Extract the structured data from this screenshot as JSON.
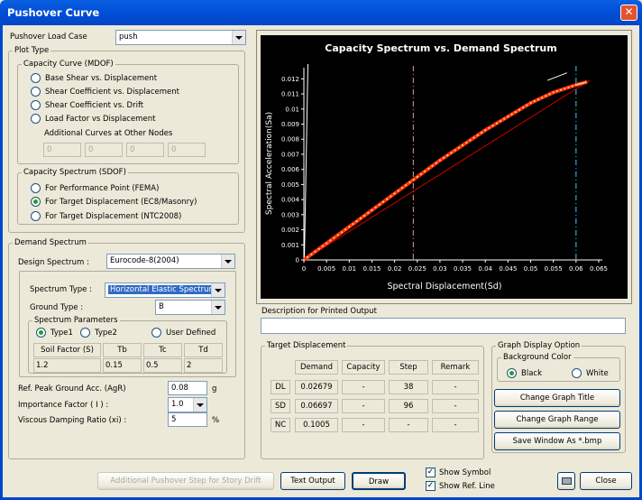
{
  "window": {
    "title": "Pushover Curve"
  },
  "load_case": {
    "label": "Pushover Load Case",
    "value": "push"
  },
  "plot_type": {
    "legend": "Plot Type",
    "mdof": {
      "legend": "Capacity Curve (MDOF)",
      "options": [
        "Base Shear vs. Displacement",
        "Shear Coefficient vs. Displacement",
        "Shear Coefficient vs. Drift",
        "Load Factor vs Displacement"
      ],
      "additional_label": "Additional Curves at Other Nodes",
      "node_values": [
        "0",
        "0",
        "0",
        "0"
      ]
    },
    "sdof": {
      "legend": "Capacity Spectrum (SDOF)",
      "options": [
        "For Performance Point (FEMA)",
        "For Target Displacement (EC8/Masonry)",
        "For Target Displacement (NTC2008)"
      ],
      "selected": 1
    }
  },
  "demand": {
    "legend": "Demand Spectrum",
    "design_label": "Design Spectrum :",
    "design_value": "Eurocode-8(2004)",
    "spectrum_type_label": "Spectrum Type :",
    "spectrum_type_value": "Horizontal Elastic Spectrum",
    "ground_type_label": "Ground Type :",
    "ground_type_value": "B",
    "params_legend": "Spectrum Parameters",
    "param_options": [
      "Type1",
      "Type2",
      "User Defined"
    ],
    "headers": [
      "Soil Factor (S)",
      "Tb",
      "Tc",
      "Td"
    ],
    "values": [
      "1.2",
      "0.15",
      "0.5",
      "2"
    ],
    "agr_label": "Ref. Peak Ground Acc. (AgR)",
    "agr_value": "0.08",
    "agr_unit": "g",
    "imp_label": "Importance Factor ( I ) :",
    "imp_value": "1.0",
    "damp_label": "Viscous Damping Ratio (xi) :",
    "damp_value": "5",
    "damp_unit": "%"
  },
  "chart_title": "Capacity Spectrum vs. Demand Spectrum",
  "chart_data": {
    "type": "line",
    "title": "Capacity Spectrum vs. Demand Spectrum",
    "xlabel": "Spectral Displacement(Sd)",
    "ylabel": "Spectral Acceleration(Sa)",
    "xlim": [
      0,
      0.065
    ],
    "ylim": [
      0,
      0.0125
    ],
    "xticks": [
      "0",
      "0.005",
      "0.01",
      "0.015",
      "0.02",
      "0.025",
      "0.03",
      "0.035",
      "0.04",
      "0.045",
      "0.05",
      "0.055",
      "0.06",
      "0.065"
    ],
    "yticks": [
      "0",
      "0.001",
      "0.002",
      "0.003",
      "0.004",
      "0.005",
      "0.006",
      "0.007",
      "0.008",
      "0.009",
      "0.01",
      "0.011",
      "0.012"
    ],
    "series": [
      {
        "color": "#ff3300",
        "x": [
          0,
          0.005,
          0.01,
          0.015,
          0.02,
          0.025,
          0.03,
          0.035,
          0.04,
          0.045,
          0.05,
          0.055,
          0.06,
          0.0625
        ],
        "y": [
          0,
          0.0011,
          0.0022,
          0.0033,
          0.0044,
          0.0055,
          0.0066,
          0.0076,
          0.0086,
          0.0095,
          0.0104,
          0.0111,
          0.0116,
          0.0118
        ]
      }
    ],
    "bilinear": {
      "color": "#cc0000",
      "x": [
        0,
        0.063
      ],
      "y": [
        0,
        0.0119
      ]
    },
    "vlines": [
      {
        "x": 0.02413,
        "color": "#c77c7c"
      },
      {
        "x": 0.06,
        "color": "#2aaecf"
      }
    ]
  },
  "description": {
    "label": "Description for Printed Output",
    "value": ""
  },
  "target": {
    "legend": "Target Displacement",
    "headers": [
      "Demand",
      "Capacity",
      "Step",
      "Remark"
    ],
    "rows": [
      {
        "name": "DL",
        "demand": "0.02679",
        "capacity": "-",
        "step": "38",
        "remark": "-"
      },
      {
        "name": "SD",
        "demand": "0.06697",
        "capacity": "-",
        "step": "96",
        "remark": "-"
      },
      {
        "name": "NC",
        "demand": "0.1005",
        "capacity": "-",
        "step": "-",
        "remark": "-"
      }
    ]
  },
  "graph_option": {
    "legend": "Graph Display Option",
    "bg_legend": "Background Color",
    "bg_options": [
      "Black",
      "White"
    ],
    "buttons": [
      "Change Graph Title",
      "Change Graph Range",
      "Save Window As *.bmp"
    ]
  },
  "bottom": {
    "additional_btn": "Additional Pushover Step for Story Drift",
    "text_output": "Text Output",
    "draw": "Draw",
    "show_symbol": "Show Symbol",
    "show_ref": "Show Ref. Line",
    "close": "Close"
  }
}
